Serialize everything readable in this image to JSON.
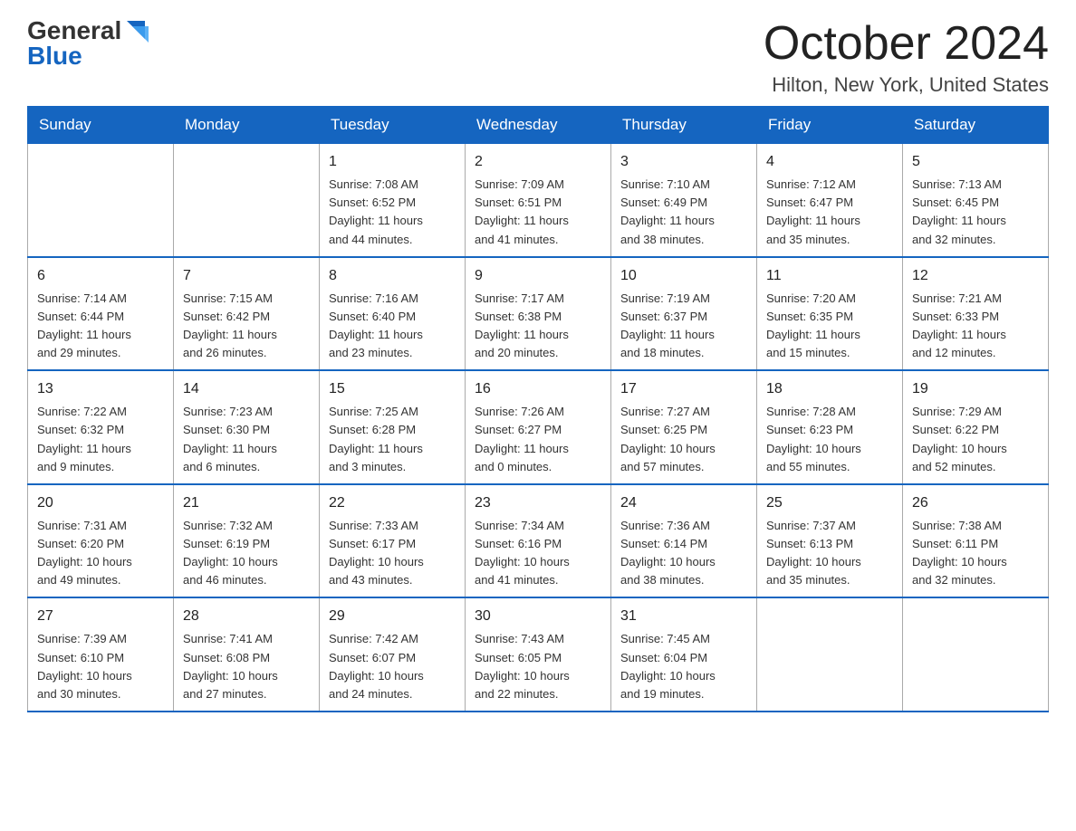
{
  "logo": {
    "general": "General",
    "blue": "Blue"
  },
  "header": {
    "month": "October 2024",
    "location": "Hilton, New York, United States"
  },
  "weekdays": [
    "Sunday",
    "Monday",
    "Tuesday",
    "Wednesday",
    "Thursday",
    "Friday",
    "Saturday"
  ],
  "weeks": [
    [
      {
        "day": "",
        "info": ""
      },
      {
        "day": "",
        "info": ""
      },
      {
        "day": "1",
        "info": "Sunrise: 7:08 AM\nSunset: 6:52 PM\nDaylight: 11 hours\nand 44 minutes."
      },
      {
        "day": "2",
        "info": "Sunrise: 7:09 AM\nSunset: 6:51 PM\nDaylight: 11 hours\nand 41 minutes."
      },
      {
        "day": "3",
        "info": "Sunrise: 7:10 AM\nSunset: 6:49 PM\nDaylight: 11 hours\nand 38 minutes."
      },
      {
        "day": "4",
        "info": "Sunrise: 7:12 AM\nSunset: 6:47 PM\nDaylight: 11 hours\nand 35 minutes."
      },
      {
        "day": "5",
        "info": "Sunrise: 7:13 AM\nSunset: 6:45 PM\nDaylight: 11 hours\nand 32 minutes."
      }
    ],
    [
      {
        "day": "6",
        "info": "Sunrise: 7:14 AM\nSunset: 6:44 PM\nDaylight: 11 hours\nand 29 minutes."
      },
      {
        "day": "7",
        "info": "Sunrise: 7:15 AM\nSunset: 6:42 PM\nDaylight: 11 hours\nand 26 minutes."
      },
      {
        "day": "8",
        "info": "Sunrise: 7:16 AM\nSunset: 6:40 PM\nDaylight: 11 hours\nand 23 minutes."
      },
      {
        "day": "9",
        "info": "Sunrise: 7:17 AM\nSunset: 6:38 PM\nDaylight: 11 hours\nand 20 minutes."
      },
      {
        "day": "10",
        "info": "Sunrise: 7:19 AM\nSunset: 6:37 PM\nDaylight: 11 hours\nand 18 minutes."
      },
      {
        "day": "11",
        "info": "Sunrise: 7:20 AM\nSunset: 6:35 PM\nDaylight: 11 hours\nand 15 minutes."
      },
      {
        "day": "12",
        "info": "Sunrise: 7:21 AM\nSunset: 6:33 PM\nDaylight: 11 hours\nand 12 minutes."
      }
    ],
    [
      {
        "day": "13",
        "info": "Sunrise: 7:22 AM\nSunset: 6:32 PM\nDaylight: 11 hours\nand 9 minutes."
      },
      {
        "day": "14",
        "info": "Sunrise: 7:23 AM\nSunset: 6:30 PM\nDaylight: 11 hours\nand 6 minutes."
      },
      {
        "day": "15",
        "info": "Sunrise: 7:25 AM\nSunset: 6:28 PM\nDaylight: 11 hours\nand 3 minutes."
      },
      {
        "day": "16",
        "info": "Sunrise: 7:26 AM\nSunset: 6:27 PM\nDaylight: 11 hours\nand 0 minutes."
      },
      {
        "day": "17",
        "info": "Sunrise: 7:27 AM\nSunset: 6:25 PM\nDaylight: 10 hours\nand 57 minutes."
      },
      {
        "day": "18",
        "info": "Sunrise: 7:28 AM\nSunset: 6:23 PM\nDaylight: 10 hours\nand 55 minutes."
      },
      {
        "day": "19",
        "info": "Sunrise: 7:29 AM\nSunset: 6:22 PM\nDaylight: 10 hours\nand 52 minutes."
      }
    ],
    [
      {
        "day": "20",
        "info": "Sunrise: 7:31 AM\nSunset: 6:20 PM\nDaylight: 10 hours\nand 49 minutes."
      },
      {
        "day": "21",
        "info": "Sunrise: 7:32 AM\nSunset: 6:19 PM\nDaylight: 10 hours\nand 46 minutes."
      },
      {
        "day": "22",
        "info": "Sunrise: 7:33 AM\nSunset: 6:17 PM\nDaylight: 10 hours\nand 43 minutes."
      },
      {
        "day": "23",
        "info": "Sunrise: 7:34 AM\nSunset: 6:16 PM\nDaylight: 10 hours\nand 41 minutes."
      },
      {
        "day": "24",
        "info": "Sunrise: 7:36 AM\nSunset: 6:14 PM\nDaylight: 10 hours\nand 38 minutes."
      },
      {
        "day": "25",
        "info": "Sunrise: 7:37 AM\nSunset: 6:13 PM\nDaylight: 10 hours\nand 35 minutes."
      },
      {
        "day": "26",
        "info": "Sunrise: 7:38 AM\nSunset: 6:11 PM\nDaylight: 10 hours\nand 32 minutes."
      }
    ],
    [
      {
        "day": "27",
        "info": "Sunrise: 7:39 AM\nSunset: 6:10 PM\nDaylight: 10 hours\nand 30 minutes."
      },
      {
        "day": "28",
        "info": "Sunrise: 7:41 AM\nSunset: 6:08 PM\nDaylight: 10 hours\nand 27 minutes."
      },
      {
        "day": "29",
        "info": "Sunrise: 7:42 AM\nSunset: 6:07 PM\nDaylight: 10 hours\nand 24 minutes."
      },
      {
        "day": "30",
        "info": "Sunrise: 7:43 AM\nSunset: 6:05 PM\nDaylight: 10 hours\nand 22 minutes."
      },
      {
        "day": "31",
        "info": "Sunrise: 7:45 AM\nSunset: 6:04 PM\nDaylight: 10 hours\nand 19 minutes."
      },
      {
        "day": "",
        "info": ""
      },
      {
        "day": "",
        "info": ""
      }
    ]
  ]
}
